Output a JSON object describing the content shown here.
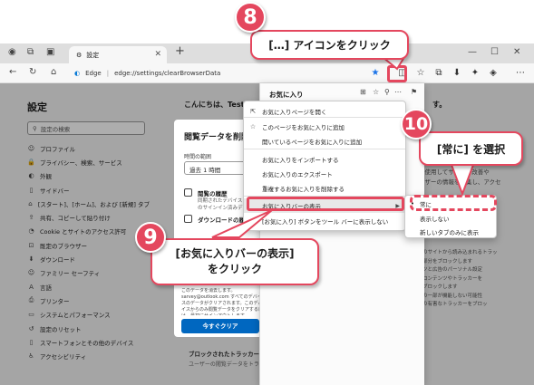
{
  "browser": {
    "tab_title": "設定",
    "address_brand": "Edge",
    "address_sep": "|",
    "address_url": "edge://settings/clearBrowserData"
  },
  "settings": {
    "title": "設定",
    "search_placeholder": "設定の検索",
    "greeting": "こんにちは、Test",
    "greeting_tail": "す。",
    "items": [
      {
        "icon": "profile-icon",
        "label": "プロファイル"
      },
      {
        "icon": "lock-icon",
        "label": "プライバシー、検索、サービス"
      },
      {
        "icon": "appearance-icon",
        "label": "外観"
      },
      {
        "icon": "sidebar-icon",
        "label": "サイドバー"
      },
      {
        "icon": "start-icon",
        "label": "[スタート]、[ホーム]、および [新規] タブ"
      },
      {
        "icon": "share-icon",
        "label": "共有、コピーして貼り付け"
      },
      {
        "icon": "cookie-icon",
        "label": "Cookie とサイトのアクセス許可"
      },
      {
        "icon": "browser-icon",
        "label": "既定のブラウザー"
      },
      {
        "icon": "download-icon",
        "label": "ダウンロード"
      },
      {
        "icon": "family-icon",
        "label": "ファミリー セーフティ"
      },
      {
        "icon": "language-icon",
        "label": "言語"
      },
      {
        "icon": "printer-icon",
        "label": "プリンター"
      },
      {
        "icon": "system-icon",
        "label": "システムとパフォーマンス"
      },
      {
        "icon": "reset-icon",
        "label": "設定のリセット"
      },
      {
        "icon": "phone-icon",
        "label": "スマートフォンとその他のデバイス"
      },
      {
        "icon": "accessibility-icon",
        "label": "アクセシビリティ"
      }
    ]
  },
  "dialog": {
    "title": "閲覧データを削除",
    "range_label": "時間の範囲",
    "range_value": "過去 1 時間",
    "chk1_label": "閲覧の履歴",
    "chk1_sub1": "同期されたデバイス",
    "chk1_sub2": "のサインイン済みデ",
    "chk2_label": "ダウンロードの履歴",
    "note": "このデータを消去します。sarvey@outlook.com すべてのデバイスのデータがクリアされます。このデバイスからのみ閲覧データをクリアするには、最初にサインアウトします。",
    "clear_button": "今すぐクリア",
    "blocked_title": "ブロックされたトラッカー",
    "blocked_sub": "ユーザーの閲覧データをトラッ"
  },
  "right_texts": [
    "を使用してサイトの改善や",
    "ーザーの情報を収集し、アクセ"
  ],
  "right_texts2": [
    "のサイトから読み込まれるトラッ",
    "部分をブロックします",
    "ツと広告のパーソナル設定",
    "コンテンツやトラッカーを",
    "ブロックします",
    "の一部が機能しない可能性",
    "の有害なトラッカーをブロッ"
  ],
  "favorites": {
    "title": "お気に入り",
    "empty_text": ""
  },
  "context_menu": [
    {
      "icon": "open-icon",
      "label": "お気に入りページを開く"
    },
    {
      "icon": "star-plus-icon",
      "label": "このページをお気に入りに追加"
    },
    {
      "icon": "",
      "label": "開いているページをお気に入りに追加"
    },
    {
      "icon": "",
      "label": "お気に入りをインポートする"
    },
    {
      "icon": "",
      "label": "お気に入りのエクスポート"
    },
    {
      "icon": "",
      "label": "重複するお気に入りを削除する"
    },
    {
      "icon": "",
      "label": "お気に入りバーの表示"
    },
    {
      "icon": "",
      "label": "[お気に入り] ボタンをツール バーに表示しない"
    }
  ],
  "submenu": [
    {
      "label": "常に",
      "checked": true
    },
    {
      "label": "表示しない",
      "checked": false
    },
    {
      "label": "新しいタブのみに表示",
      "checked": false
    }
  ],
  "annotations": {
    "step8_num": "8",
    "step8_text": "[…] アイコンをクリック",
    "step9_num": "9",
    "step9_line1": "[お気に入りバーの表示]",
    "step9_line2": "をクリック",
    "step10_num": "10",
    "step10_text": "[常に] を選択"
  },
  "colors": {
    "accent": "#e4475e",
    "button_blue": "#0067c0"
  }
}
